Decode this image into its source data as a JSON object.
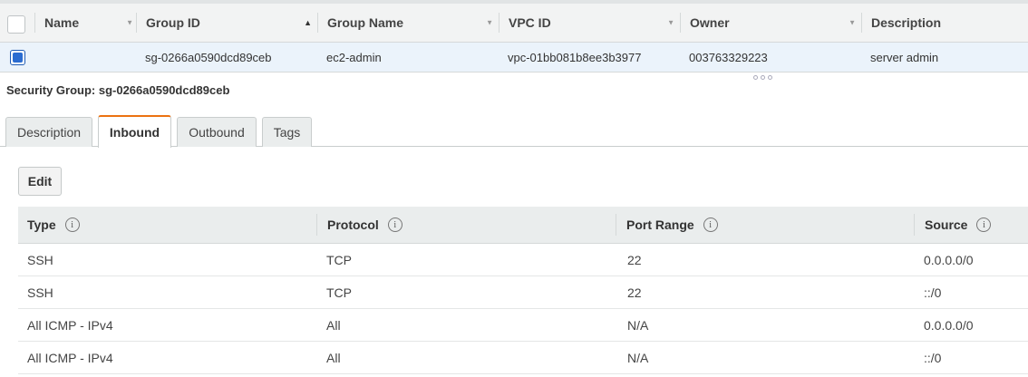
{
  "top_table": {
    "columns": [
      {
        "label": "Name"
      },
      {
        "label": "Group ID"
      },
      {
        "label": "Group Name"
      },
      {
        "label": "VPC ID"
      },
      {
        "label": "Owner"
      },
      {
        "label": "Description"
      }
    ],
    "row": {
      "name": "",
      "group_id": "sg-0266a0590dcd89ceb",
      "group_name": "ec2-admin",
      "vpc_id": "vpc-01bb081b8ee3b3977",
      "owner": "003763329223",
      "description": "server admin"
    }
  },
  "detail": {
    "title": "Security Group: sg-0266a0590dcd89ceb"
  },
  "tabs": [
    {
      "label": "Description"
    },
    {
      "label": "Inbound"
    },
    {
      "label": "Outbound"
    },
    {
      "label": "Tags"
    }
  ],
  "active_tab": "Inbound",
  "edit_label": "Edit",
  "rules_table": {
    "columns": [
      {
        "label": "Type"
      },
      {
        "label": "Protocol"
      },
      {
        "label": "Port Range"
      },
      {
        "label": "Source"
      }
    ],
    "info_glyph": "i",
    "rows": [
      {
        "type": "SSH",
        "protocol": "TCP",
        "port_range": "22",
        "source": "0.0.0.0/0"
      },
      {
        "type": "SSH",
        "protocol": "TCP",
        "port_range": "22",
        "source": "::/0"
      },
      {
        "type": "All ICMP - IPv4",
        "protocol": "All",
        "port_range": "N/A",
        "source": "0.0.0.0/0"
      },
      {
        "type": "All ICMP - IPv4",
        "protocol": "All",
        "port_range": "N/A",
        "source": "::/0"
      }
    ]
  },
  "colors": {
    "selected_row": "#ebf3fb",
    "active_tab_accent": "#ec7211",
    "checkbox_fill": "#2b6cd0"
  }
}
